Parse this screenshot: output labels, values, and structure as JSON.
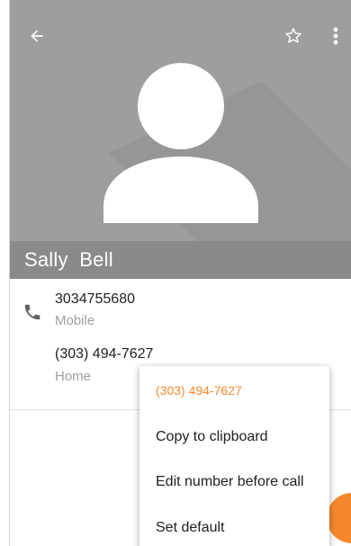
{
  "contact": {
    "name": "Sally  Bell",
    "phones": [
      {
        "number": "3034755680",
        "type": "Mobile"
      },
      {
        "number": "(303) 494-7627",
        "type": "Home"
      }
    ]
  },
  "toolbar": {
    "back_icon": "arrow-back-icon",
    "star_icon": "star-outline-icon",
    "more_icon": "more-vert-icon"
  },
  "context_menu": {
    "title": "(303) 494-7627",
    "items": [
      "Copy to clipboard",
      "Edit number before call",
      "Set default"
    ]
  },
  "colors": {
    "header_bg": "#9e9e9e",
    "name_bar_bg": "#8a8a8a",
    "accent": "#f5882b"
  }
}
